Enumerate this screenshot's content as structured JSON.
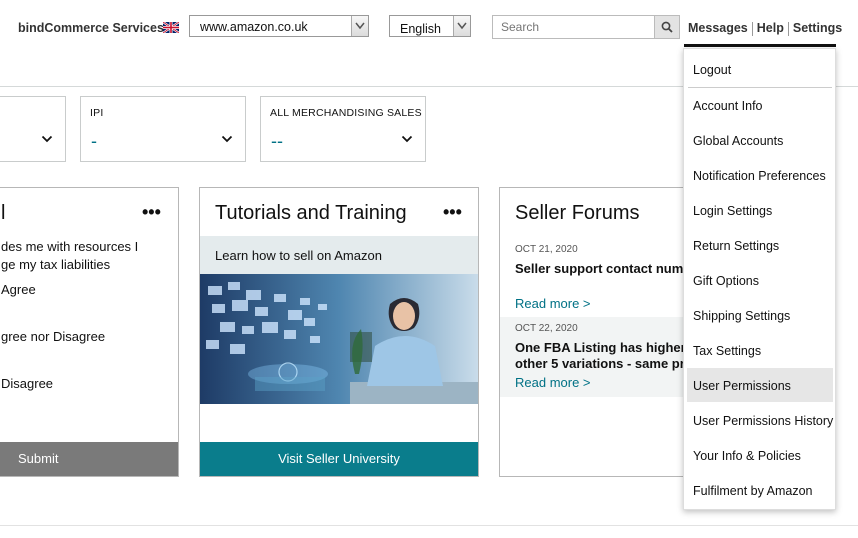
{
  "header": {
    "brand": "bindCommerce Services",
    "marketplace_select": "www.amazon.co.uk",
    "language_select": "English",
    "search_placeholder": "Search",
    "links": [
      "Messages",
      "Help",
      "Settings"
    ]
  },
  "metrics": [
    {
      "label": "",
      "value": ""
    },
    {
      "label": "IPI",
      "value": "-"
    },
    {
      "label": "ALL MERCHANDISING SALES",
      "value": "--"
    }
  ],
  "survey_card": {
    "title": "l",
    "text_line1": "des me with resources I",
    "text_line2": "ge my tax liabilities",
    "options": [
      "Agree",
      "gree nor Disagree",
      "Disagree"
    ],
    "button": "Submit"
  },
  "tutorials_card": {
    "title": "Tutorials and Training",
    "subtitle": "Learn how to sell on Amazon",
    "button": "Visit Seller University"
  },
  "forums_card": {
    "title": "Seller Forums",
    "posts": [
      {
        "date": "OCT 21, 2020",
        "title_line1": "Seller support contact num",
        "title_line2": "",
        "read_more": "Read more >"
      },
      {
        "date": "OCT 22, 2020",
        "title_line1": "One FBA Listing has higher",
        "title_line2": "other 5 variations - same pr",
        "read_more": "Read more >"
      }
    ]
  },
  "settings_menu": [
    "Logout",
    "Account Info",
    "Global Accounts",
    "Notification Preferences",
    "Login Settings",
    "Return Settings",
    "Gift Options",
    "Shipping Settings",
    "Tax Settings",
    "User Permissions",
    "User Permissions History",
    "Your Info & Policies",
    "Fulfilment by Amazon"
  ],
  "colors": {
    "accent_teal": "#007185",
    "button_teal": "#0a7d8c",
    "submit_gray": "#7a7a7a",
    "highlight": "#e6e6e6"
  },
  "icons": [
    "uk-flag-icon",
    "search-icon",
    "chevron-down-icon",
    "more-dots-icon"
  ]
}
